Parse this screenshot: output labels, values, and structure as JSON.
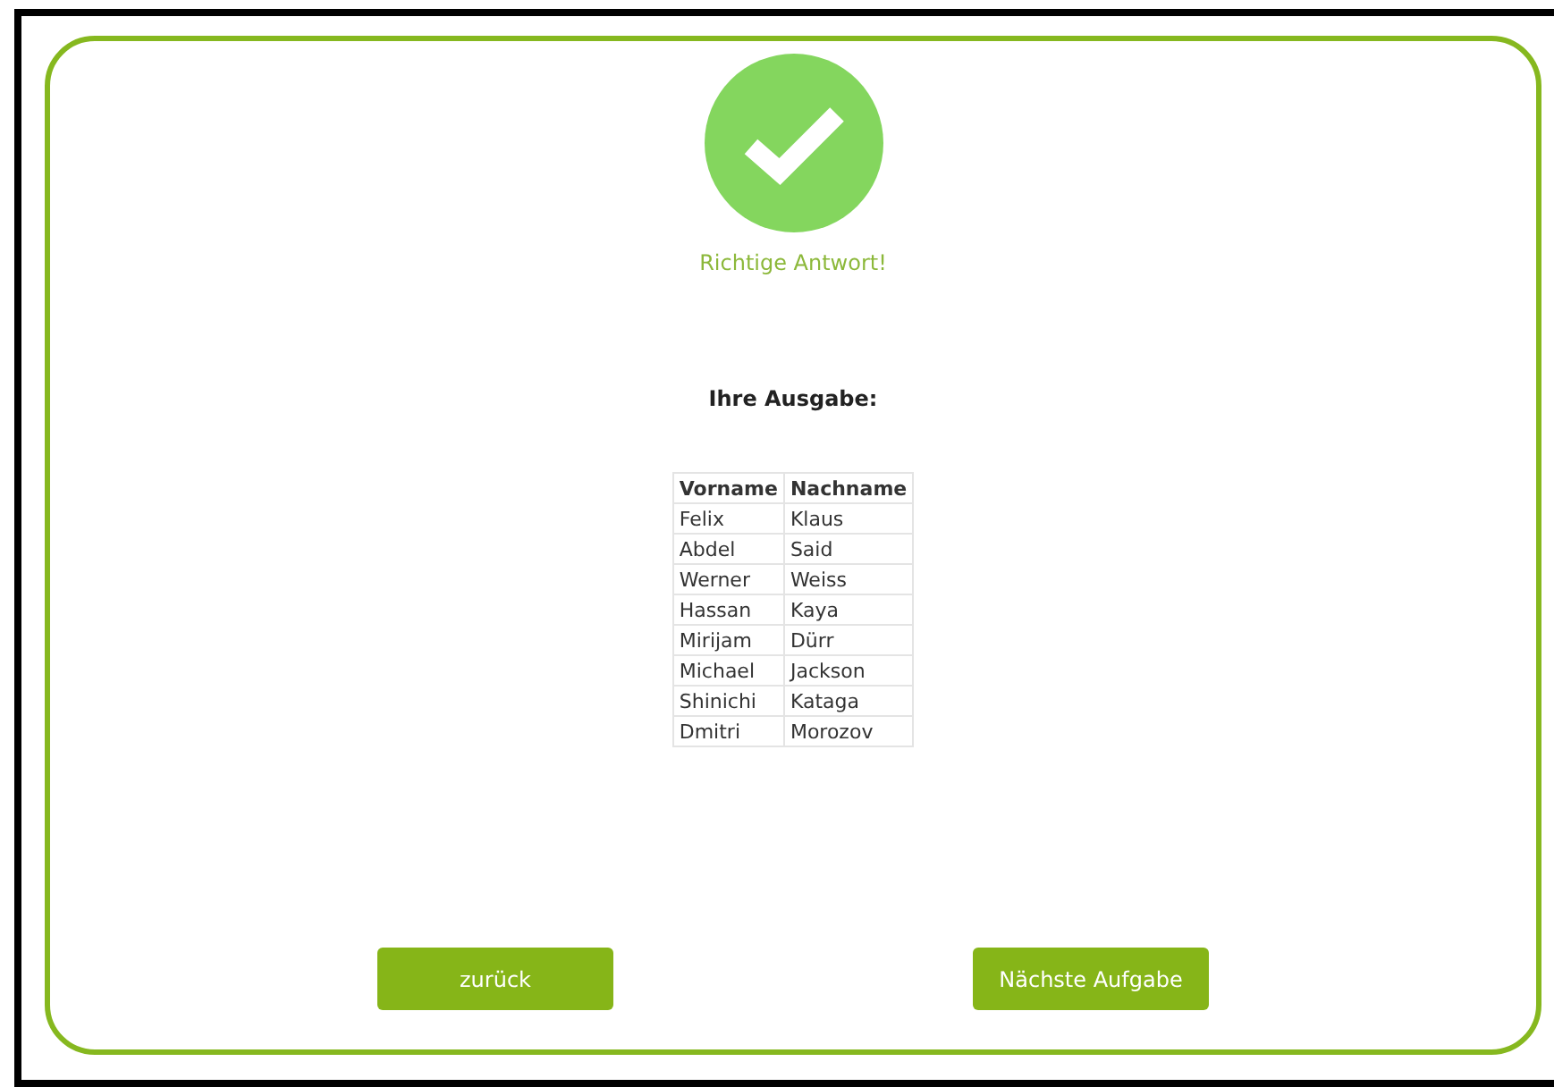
{
  "result": {
    "message": "Richtige Antwort!",
    "correct": true
  },
  "output": {
    "heading": "Ihre Ausgabe:",
    "columns": [
      "Vorname",
      "Nachname"
    ],
    "rows": [
      [
        "Felix",
        "Klaus"
      ],
      [
        "Abdel",
        "Said"
      ],
      [
        "Werner",
        "Weiss"
      ],
      [
        "Hassan",
        "Kaya"
      ],
      [
        "Mirijam",
        "Dürr"
      ],
      [
        "Michael",
        "Jackson"
      ],
      [
        "Shinichi",
        "Kataga"
      ],
      [
        "Dmitri",
        "Morozov"
      ]
    ]
  },
  "buttons": [
    "zurück",
    "Nächste Aufgabe"
  ]
}
